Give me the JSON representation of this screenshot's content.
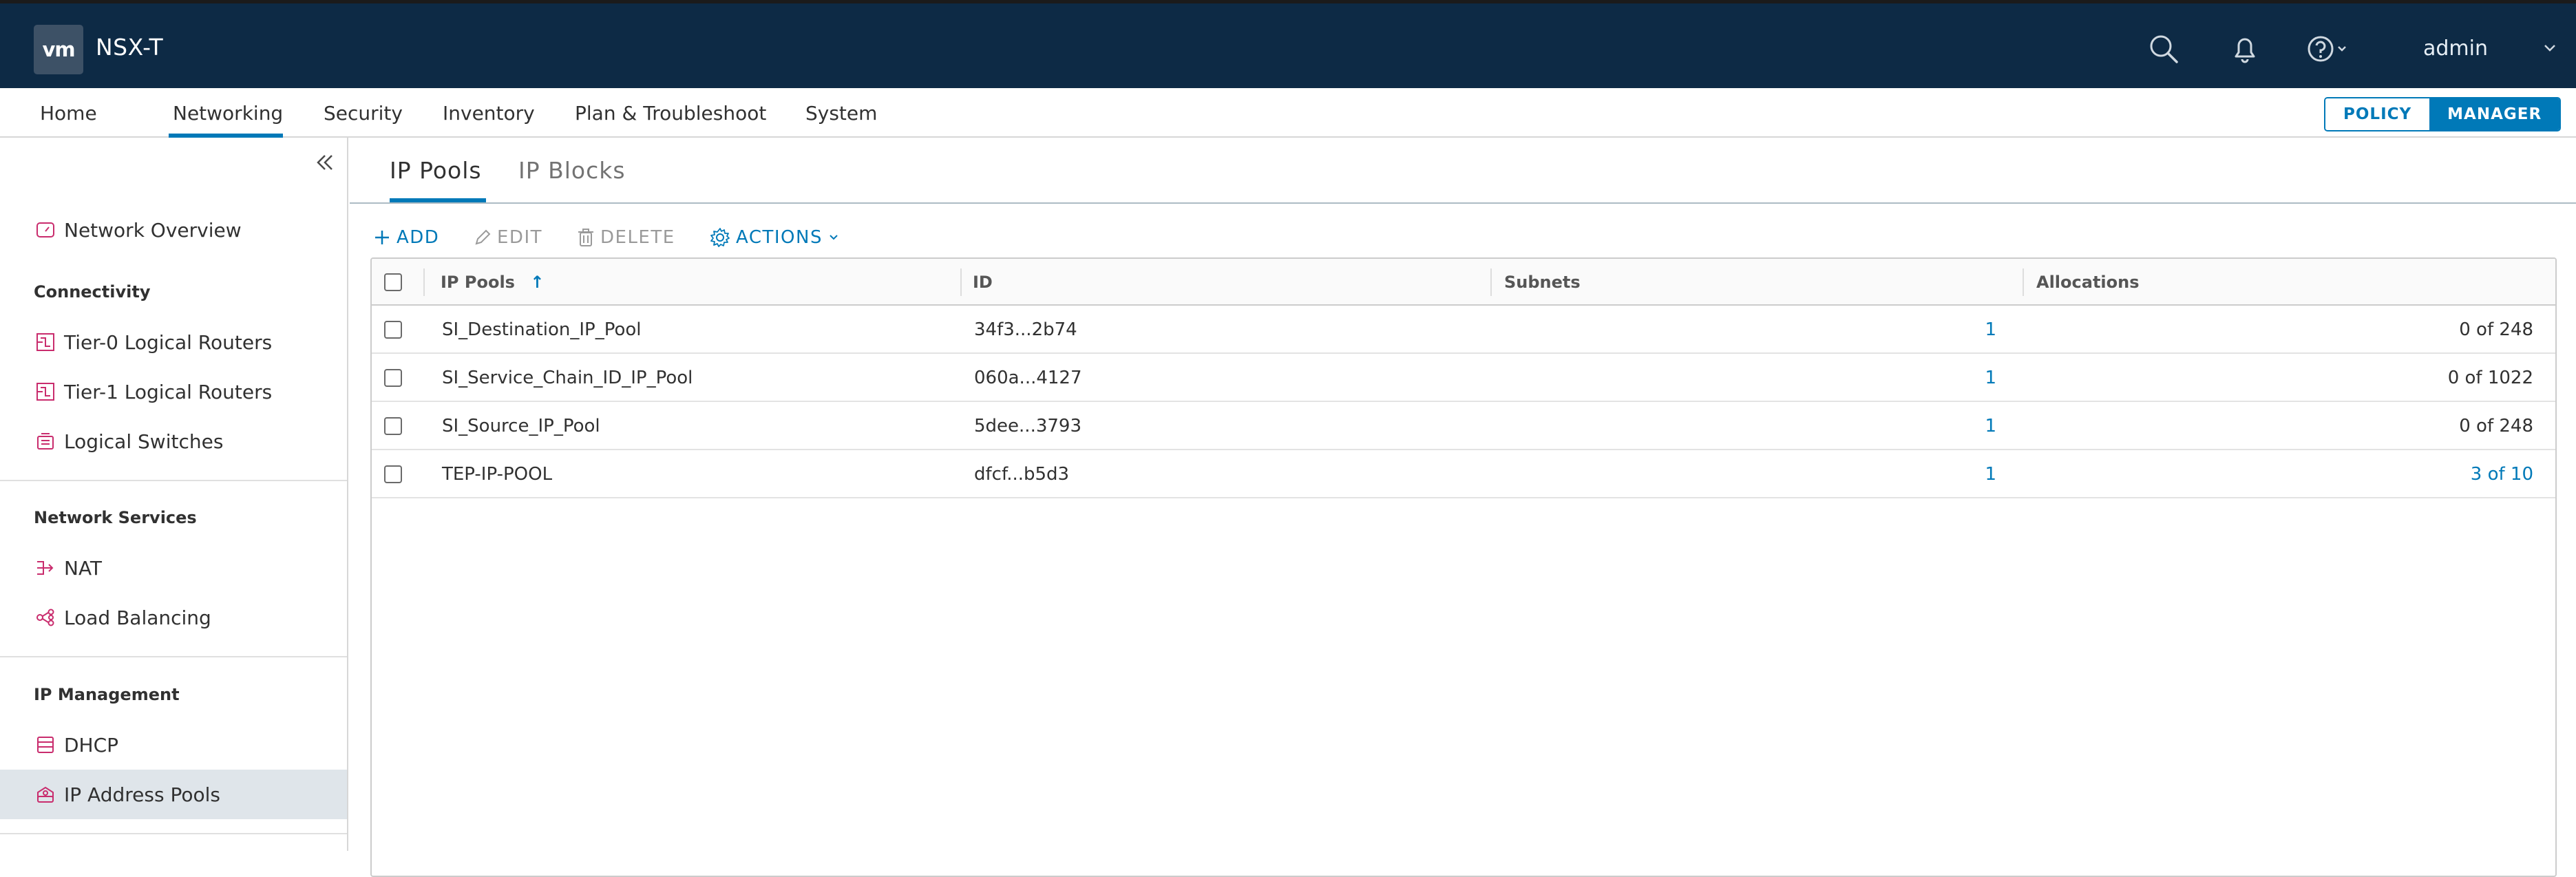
{
  "header": {
    "logo_text": "vm",
    "app_name": "NSX-T",
    "user": "admin"
  },
  "nav": {
    "items": [
      "Home",
      "Networking",
      "Security",
      "Inventory",
      "Plan & Troubleshoot",
      "System"
    ],
    "active": "Networking"
  },
  "mode": {
    "policy": "POLICY",
    "manager": "MANAGER",
    "active": "MANAGER"
  },
  "sidebar": {
    "overview": "Network Overview",
    "sections": [
      {
        "title": "Connectivity",
        "items": [
          "Tier-0 Logical Routers",
          "Tier-1 Logical Routers",
          "Logical Switches"
        ]
      },
      {
        "title": "Network Services",
        "items": [
          "NAT",
          "Load Balancing"
        ]
      },
      {
        "title": "IP Management",
        "items": [
          "DHCP",
          "IP Address Pools"
        ]
      }
    ],
    "selected": "IP Address Pools"
  },
  "tabs": {
    "items": [
      "IP Pools",
      "IP Blocks"
    ],
    "active": "IP Pools"
  },
  "toolbar": {
    "add": "ADD",
    "edit": "EDIT",
    "delete": "DELETE",
    "actions": "ACTIONS"
  },
  "table": {
    "columns": [
      "IP Pools",
      "ID",
      "Subnets",
      "Allocations"
    ],
    "sort_column": "IP Pools",
    "rows": [
      {
        "name": "SI_Destination_IP_Pool",
        "id": "34f3...2b74",
        "subnets": "1",
        "allocations": "0 of 248"
      },
      {
        "name": "SI_Service_Chain_ID_IP_Pool",
        "id": "060a...4127",
        "subnets": "1",
        "allocations": "0 of 1022"
      },
      {
        "name": "SI_Source_IP_Pool",
        "id": "5dee...3793",
        "subnets": "1",
        "allocations": "0 of 248"
      },
      {
        "name": "TEP-IP-POOL",
        "id": "dfcf...b5d3",
        "subnets": "1",
        "allocations": "3 of 10"
      }
    ]
  },
  "colors": {
    "header_bg": "#0d2a45",
    "accent": "#0079b8",
    "icon_pink": "#c92c6d"
  }
}
